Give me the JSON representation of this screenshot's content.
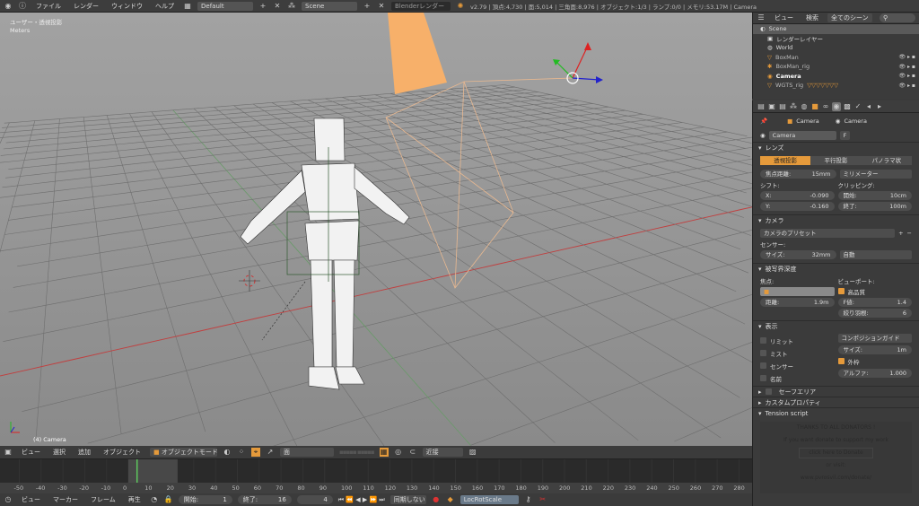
{
  "topbar": {
    "menus": [
      "ファイル",
      "レンダー",
      "ウィンドウ",
      "ヘルプ"
    ],
    "layout": "Default",
    "scene": "Scene",
    "engine": "Blenderレンダー",
    "stats": "v2.79 | 頂点:4,730 | 面:5,014 | 三角面:8,976 | オブジェクト:1/3 | ランプ:0/0 | メモリ:53.17M | Camera"
  },
  "viewport": {
    "view_label": "ユーザー・透視投影",
    "units": "Meters",
    "object_label": "(4) Camera"
  },
  "outliner": {
    "menus": [
      "ビュー",
      "検索"
    ],
    "filter": "全てのシーン",
    "items": [
      {
        "name": "Scene",
        "level": 0
      },
      {
        "name": "レンダーレイヤー",
        "level": 1
      },
      {
        "name": "World",
        "level": 1
      },
      {
        "name": "BoxMan",
        "level": 1
      },
      {
        "name": "BoxMan_rig",
        "level": 1
      },
      {
        "name": "Camera",
        "level": 1
      },
      {
        "name": "WGTS_rig",
        "level": 1
      }
    ]
  },
  "properties": {
    "breadcrumb": [
      "Camera",
      "Camera"
    ],
    "datablock": "Camera",
    "fake_user": "F",
    "lens": {
      "title": "レンズ",
      "modes": [
        "透視投影",
        "平行投影",
        "パノラマ状"
      ],
      "active_mode": 0,
      "focal_label": "焦点距離:",
      "focal": "15mm",
      "unit": "ミリメーター",
      "shift_label": "シフト:",
      "x_label": "X:",
      "x": "-0.090",
      "y_label": "Y:",
      "y": "-0.160",
      "clip_label": "クリッピング:",
      "start_label": "開始:",
      "start": "10cm",
      "end_label": "終了:",
      "end": "100m"
    },
    "camera": {
      "title": "カメラ",
      "preset": "カメラのプリセット",
      "sensor_label": "センサー:",
      "size_label": "サイズ:",
      "size": "32mm",
      "fit": "自動"
    },
    "dof": {
      "title": "被写界深度",
      "focus_label": "焦点:",
      "distance_label": "距離:",
      "distance": "1.9m",
      "viewport_label": "ビューポート:",
      "hq_label": "高品質",
      "fstop_label": "F値:",
      "fstop": "1.4",
      "blades_label": "絞り羽根:",
      "blades": "6"
    },
    "display": {
      "title": "表示",
      "checks": [
        "リミット",
        "ミスト",
        "センサー",
        "名前"
      ],
      "guide": "コンポジションガイド",
      "size_label": "サイズ:",
      "size": "1m",
      "frame_label": "外枠",
      "alpha_label": "アルファ:",
      "alpha": "1.000"
    },
    "collapsed": [
      "セーフエリア",
      "カスタムプロパティ"
    ],
    "tension": {
      "title": "Tension script",
      "thanks": "THANKS TO ALL DONATORS !",
      "support": "If you want donate to support my work",
      "donate": "click here to Donate",
      "visit": "or visit:",
      "url": "www.pvrosvil.com/donate/"
    }
  },
  "view3d_header": {
    "menus": [
      "ビュー",
      "選択",
      "追加",
      "オブジェクト"
    ],
    "mode": "オブジェクトモード",
    "orientation": "面",
    "snap": "近接"
  },
  "timeline": {
    "ticks": [
      "-50",
      "-40",
      "-30",
      "-20",
      "-10",
      "0",
      "10",
      "20",
      "30",
      "40",
      "50",
      "60",
      "70",
      "80",
      "90",
      "100",
      "110",
      "120",
      "130",
      "140",
      "150",
      "160",
      "170",
      "180",
      "190",
      "200",
      "210",
      "220",
      "230",
      "240",
      "250",
      "260",
      "270",
      "280"
    ],
    "current_frame": 4,
    "frame_start": 1,
    "frame_end": 16
  },
  "timeline_header": {
    "menus": [
      "ビュー",
      "マーカー",
      "フレーム",
      "再生"
    ],
    "start_label": "開始:",
    "start": "1",
    "end_label": "終了:",
    "end": "16",
    "current": "4",
    "sync": "同期しない",
    "keyset": "LocRotScale"
  },
  "colors": {
    "accent": "#e59a3b",
    "playhead": "#5ec65e",
    "x_axis": "#c04040"
  }
}
